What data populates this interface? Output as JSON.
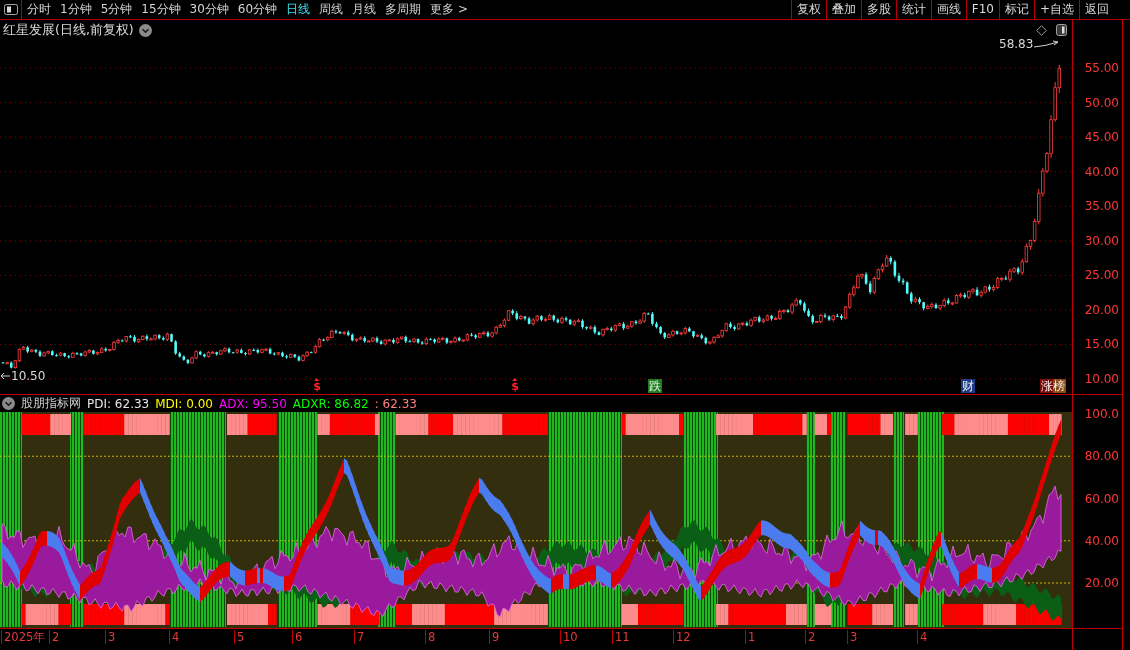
{
  "toolbar": {
    "periods": [
      {
        "label": "分时",
        "selected": false
      },
      {
        "label": "1分钟",
        "selected": false
      },
      {
        "label": "5分钟",
        "selected": false
      },
      {
        "label": "15分钟",
        "selected": false
      },
      {
        "label": "30分钟",
        "selected": false
      },
      {
        "label": "60分钟",
        "selected": false
      },
      {
        "label": "日线",
        "selected": true
      },
      {
        "label": "周线",
        "selected": false
      },
      {
        "label": "月线",
        "selected": false
      },
      {
        "label": "多周期",
        "selected": false
      },
      {
        "label": "更多 >",
        "selected": false
      }
    ],
    "buttons": [
      "复权",
      "叠加",
      "多股",
      "统计",
      "画线",
      "F10",
      "标记",
      "+自选",
      "返回"
    ]
  },
  "price_pane": {
    "title": "红星发展(日线,前复权)",
    "high_label": "58.83",
    "low_label": "10.50",
    "axis_labels": [
      "55.00",
      "50.00",
      "45.00",
      "40.00",
      "35.00",
      "30.00",
      "25.00",
      "20.00",
      "15.00",
      "10.00"
    ],
    "events": [
      {
        "kind": "dollar",
        "label": "$"
      },
      {
        "kind": "dollar",
        "label": "$"
      },
      {
        "kind": "badge",
        "label": "跌",
        "color": "#1f7f1f"
      },
      {
        "kind": "badge",
        "label": "财",
        "color": "#1b3c84"
      },
      {
        "kind": "split",
        "label": "涨榜",
        "color": "#7c0a0a"
      }
    ]
  },
  "indicator_pane": {
    "name": "股朋指标网",
    "readings": [
      {
        "kind": "pdi",
        "text": "PDI: 62.33"
      },
      {
        "kind": "mdi",
        "text": "MDI: 0.00"
      },
      {
        "kind": "adx",
        "text": "ADX: 95.50"
      },
      {
        "kind": "adxr",
        "text": "ADXR: 86.82"
      },
      {
        "kind": "extra",
        "text": ": 62.33"
      }
    ],
    "axis_labels": [
      "100.0",
      "80.00",
      "60.00",
      "40.00",
      "20.00"
    ]
  },
  "time_axis": {
    "labels": [
      "2025年",
      "2",
      "3",
      "4",
      "5",
      "6",
      "7",
      "8",
      "9",
      "10",
      "11",
      "12",
      "1",
      "2",
      "3",
      "4"
    ]
  }
}
